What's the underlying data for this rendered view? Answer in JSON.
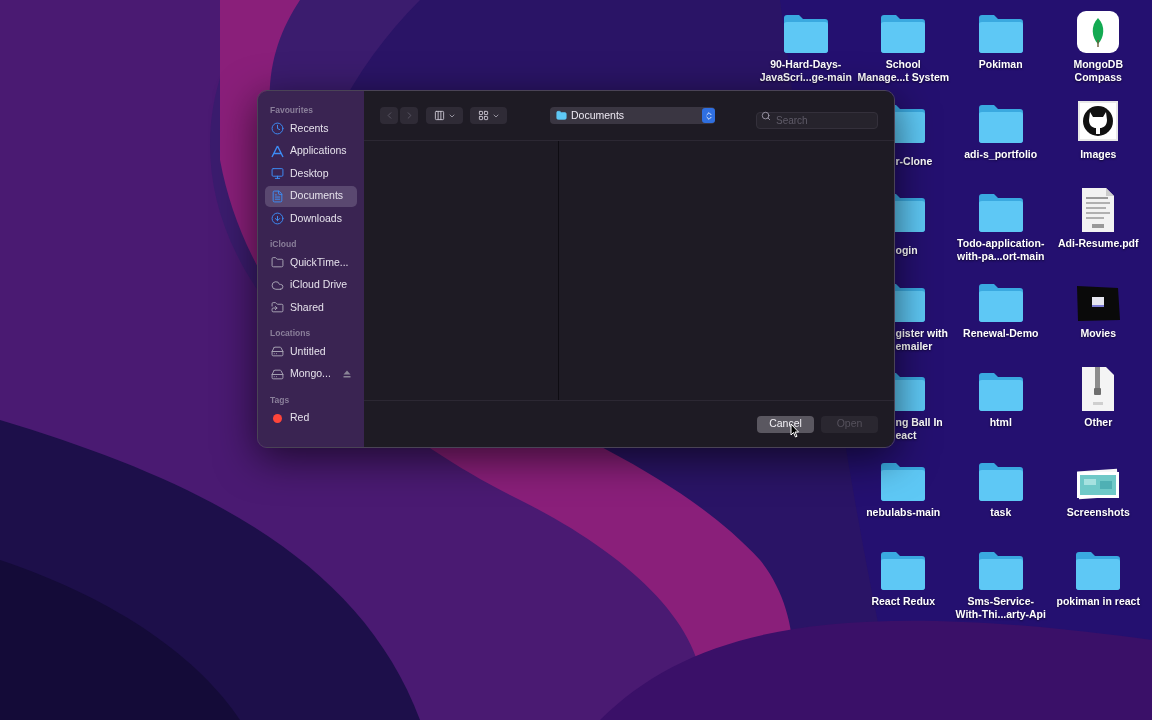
{
  "desktop_columns": [
    {
      "items": [
        {
          "kind": "folder",
          "label": "90-Hard-Days-\nJavaScri...ge-main"
        }
      ]
    },
    {
      "items": [
        {
          "kind": "folder",
          "label": "School\nManage...t System"
        },
        {
          "kind": "partial",
          "label": "r-Clone"
        },
        {
          "kind": "partial",
          "label": "ogin"
        },
        {
          "kind": "partial",
          "label": "gister with\nemailer"
        },
        {
          "kind": "partial",
          "label": "ng Ball In\neact"
        },
        {
          "kind": "folder",
          "label": "nebulabs-main"
        },
        {
          "kind": "folder",
          "label": "React Redux"
        }
      ]
    },
    {
      "items": [
        {
          "kind": "folder",
          "label": "Pokiman"
        },
        {
          "kind": "folder",
          "label": "adi-s_portfolio"
        },
        {
          "kind": "folder",
          "label": "Todo-application-\nwith-pa...ort-main"
        },
        {
          "kind": "folder",
          "label": "Renewal-Demo"
        },
        {
          "kind": "folder",
          "label": "html"
        },
        {
          "kind": "folder",
          "label": "task"
        },
        {
          "kind": "folder",
          "label": "Sms-Service-\nWith-Thi...arty-Api"
        }
      ]
    },
    {
      "items": [
        {
          "kind": "app",
          "label": "MongoDB\nCompass"
        },
        {
          "label": "Images"
        },
        {
          "kind": "pdf",
          "label": "Adi-Resume.pdf"
        },
        {
          "kind": "video",
          "label": "Movies"
        },
        {
          "kind": "zip",
          "label": "Other"
        },
        {
          "kind": "photos",
          "label": "Screenshots"
        },
        {
          "kind": "folder",
          "label": "pokiman in react"
        }
      ]
    }
  ],
  "dialog": {
    "sidebar": [
      {
        "heading": "Favourites",
        "items": [
          {
            "kind": "clock",
            "label": "Recents",
            "selected": false
          },
          {
            "kind": "apps",
            "label": "Applications",
            "selected": false
          },
          {
            "kind": "desktop",
            "label": "Desktop",
            "selected": false
          },
          {
            "kind": "doc",
            "label": "Documents",
            "selected": true
          },
          {
            "kind": "download",
            "label": "Downloads",
            "selected": false
          }
        ]
      },
      {
        "heading": "iCloud",
        "items": [
          {
            "kind": "folder",
            "label": "QuickTime...",
            "selected": false
          },
          {
            "kind": "cloud",
            "label": "iCloud Drive",
            "selected": false
          },
          {
            "kind": "shared",
            "label": "Shared",
            "selected": false
          }
        ]
      },
      {
        "heading": "Locations",
        "items": [
          {
            "kind": "disk",
            "label": "Untitled",
            "selected": false
          },
          {
            "kind": "disk",
            "label": "Mongo...",
            "selected": false,
            "ejectable": true
          }
        ]
      },
      {
        "heading": "Tags",
        "items": [
          {
            "kind": "tag",
            "label": "Red",
            "selected": false,
            "color": "#ff453a"
          }
        ]
      }
    ],
    "location": "Documents",
    "search": {
      "placeholder": "Search"
    },
    "buttons": [
      {
        "label": "Cancel",
        "disabled": false
      },
      {
        "label": "Open",
        "disabled": true
      }
    ]
  }
}
